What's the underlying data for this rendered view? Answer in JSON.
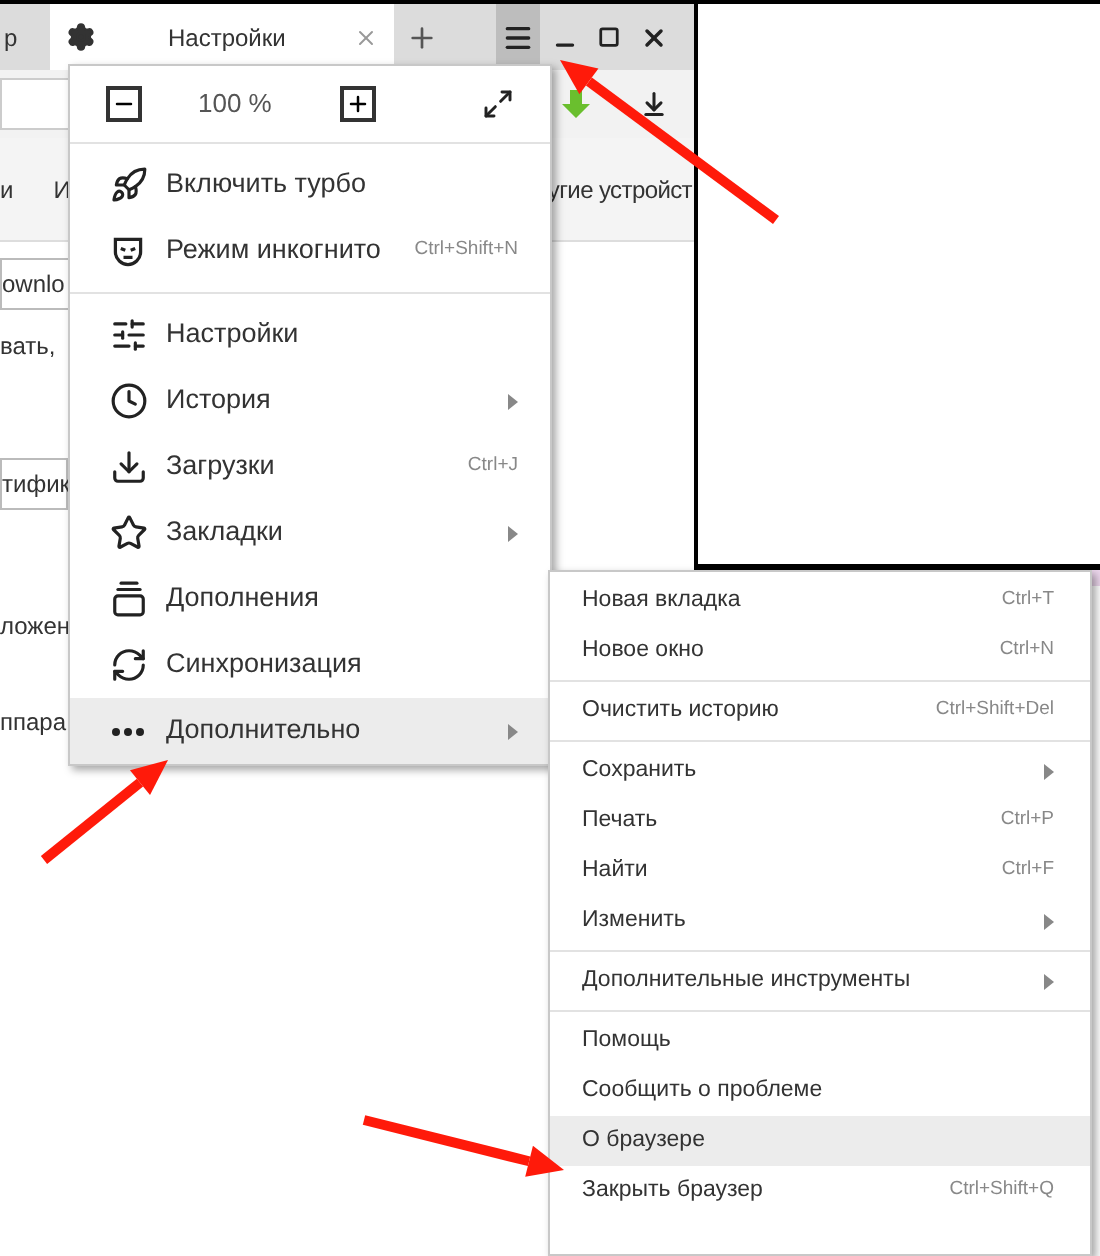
{
  "tabs": [
    {
      "title": "р",
      "selected": false
    },
    {
      "title": "Настройки",
      "selected": true
    }
  ],
  "page_fragments": {
    "nav": [
      "и",
      "И",
      "угие устройст"
    ],
    "lines": [
      "ownlo",
      "вать,",
      "тифик",
      "ложен",
      "ппара"
    ]
  },
  "main_menu": {
    "zoom": "100 %",
    "sections": [
      {
        "items": [
          {
            "label": "Включить турбо",
            "selected": false
          },
          {
            "label": "Режим инкогнито",
            "shortcut": "Ctrl+Shift+N",
            "selected": false
          }
        ]
      },
      {
        "items": [
          {
            "label": "Настройки",
            "selected": false
          },
          {
            "label": "История",
            "submenu": true,
            "selected": false
          },
          {
            "label": "Загрузки",
            "shortcut": "Ctrl+J",
            "selected": false
          },
          {
            "label": "Закладки",
            "submenu": true,
            "selected": false
          },
          {
            "label": "Дополнения",
            "selected": false
          },
          {
            "label": "Синхронизация",
            "selected": false
          },
          {
            "label": "Дополнительно",
            "submenu": true,
            "selected": true
          }
        ]
      }
    ]
  },
  "submenu": {
    "sections": [
      {
        "items": [
          {
            "label": "Новая вкладка",
            "shortcut": "Ctrl+T",
            "selected": false
          },
          {
            "label": "Новое окно",
            "shortcut": "Ctrl+N",
            "selected": false
          }
        ]
      },
      {
        "items": [
          {
            "label": "Очистить историю",
            "shortcut": "Ctrl+Shift+Del",
            "selected": false
          }
        ]
      },
      {
        "items": [
          {
            "label": "Сохранить",
            "submenu": true,
            "selected": false
          },
          {
            "label": "Печать",
            "shortcut": "Ctrl+P",
            "selected": false
          },
          {
            "label": "Найти",
            "shortcut": "Ctrl+F",
            "selected": false
          },
          {
            "label": "Изменить",
            "submenu": true,
            "selected": false
          }
        ]
      },
      {
        "items": [
          {
            "label": "Дополнительные инструменты",
            "submenu": true,
            "selected": false
          }
        ]
      },
      {
        "items": [
          {
            "label": "Помощь",
            "selected": false
          },
          {
            "label": "Сообщить о проблеме",
            "selected": false
          },
          {
            "label": "О браузере",
            "selected": true
          },
          {
            "label": "Закрыть браузер",
            "shortcut": "Ctrl+Shift+Q",
            "selected": false
          }
        ]
      }
    ]
  }
}
